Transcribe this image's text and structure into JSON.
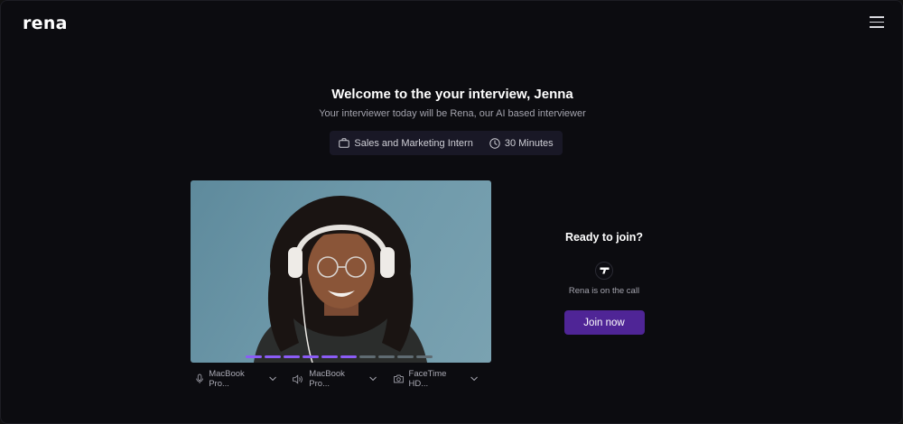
{
  "app": {
    "logo": "rena"
  },
  "header": {
    "title": "Welcome to the your interview, Jenna",
    "subtitle": "Your interviewer today will be Rena, our AI based interviewer"
  },
  "meta": {
    "role": "Sales and Marketing Intern",
    "role_icon": "briefcase-icon",
    "duration": "30 Minutes",
    "duration_icon": "clock-icon"
  },
  "video": {
    "progress_total": 10,
    "progress_active": 6,
    "active_color": "#8b5cf6",
    "inactive_color": "#5f6b72"
  },
  "devices": [
    {
      "icon": "microphone-icon",
      "label": "MacBook Pro..."
    },
    {
      "icon": "speaker-icon",
      "label": "MacBook Pro..."
    },
    {
      "icon": "camera-icon",
      "label": "FaceTime HD..."
    }
  ],
  "join": {
    "ready_label": "Ready to join?",
    "agent_status": "Rena is on the call",
    "button_label": "Join now",
    "button_color": "#4f2596"
  }
}
